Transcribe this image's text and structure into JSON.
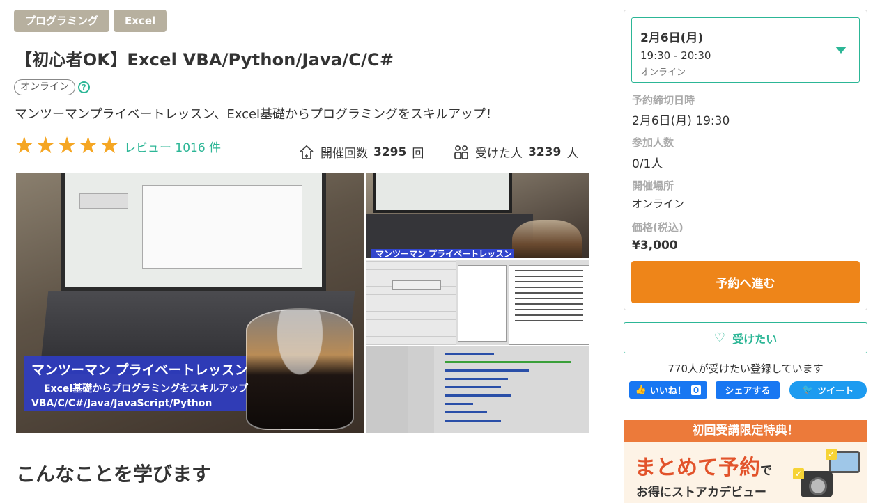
{
  "tags": [
    "プログラミング",
    "Excel"
  ],
  "title": "【初心者OK】Excel VBA/Python/Java/C/C#",
  "online_badge": "オンライン",
  "help_icon": "?",
  "subtitle": "マンツーマンプライベートレッスン、Excel基礎からプログラミングをスキルアップ！",
  "rating": {
    "stars_filled": 5,
    "stars_total": 5,
    "review_label": "レビュー 1016 件",
    "colors": {
      "star": "#f5a623",
      "link": "#2cb696"
    }
  },
  "stats": {
    "held_label": "開催回数",
    "held_value": "3295",
    "held_unit": "回",
    "attended_label": "受けた人",
    "attended_value": "3239",
    "attended_unit": "人"
  },
  "gallery": {
    "banner_line1": "マンツーマン  プライベートレッスン",
    "banner_line2": "Excel基礎からプログラミングをスキルアップ",
    "banner_line3": "VBA/C/C#/Java/JavaScript/Python",
    "thumb1_label": "マンツーマン  プライベートレッスン"
  },
  "learn_heading": "こんなことを学びます",
  "schedule": {
    "date": "2月6日(月)",
    "time": "19:30 - 20:30",
    "mode": "オンライン",
    "deadline_label": "予約締切日時",
    "deadline_value": "2月6日(月) 19:30",
    "participants_label": "参加人数",
    "participants_value": "0/1人",
    "location_label": "開催場所",
    "location_value": "オンライン",
    "price_label": "価格(税込)",
    "price_value": "¥3,000",
    "reserve_button": "予約へ進む"
  },
  "want": {
    "button": "受けたい",
    "count_text": "770人が受けたい登録しています"
  },
  "social": {
    "like_label": "いいね！",
    "like_count": "0",
    "share_label": "シェアする",
    "tweet_label": "ツイート"
  },
  "promo": {
    "header": "初回受講限定特典！",
    "main": "まとめて予約",
    "main_suffix": "で",
    "sub": "お得にストアカデビュー"
  },
  "colors": {
    "accent": "#2cb696",
    "reserve": "#ee8519",
    "tag": "#b7b09f",
    "facebook": "#1877f2",
    "twitter": "#1d9bf0",
    "promo_header": "#ec7a3a",
    "promo_text": "#e2532b"
  }
}
